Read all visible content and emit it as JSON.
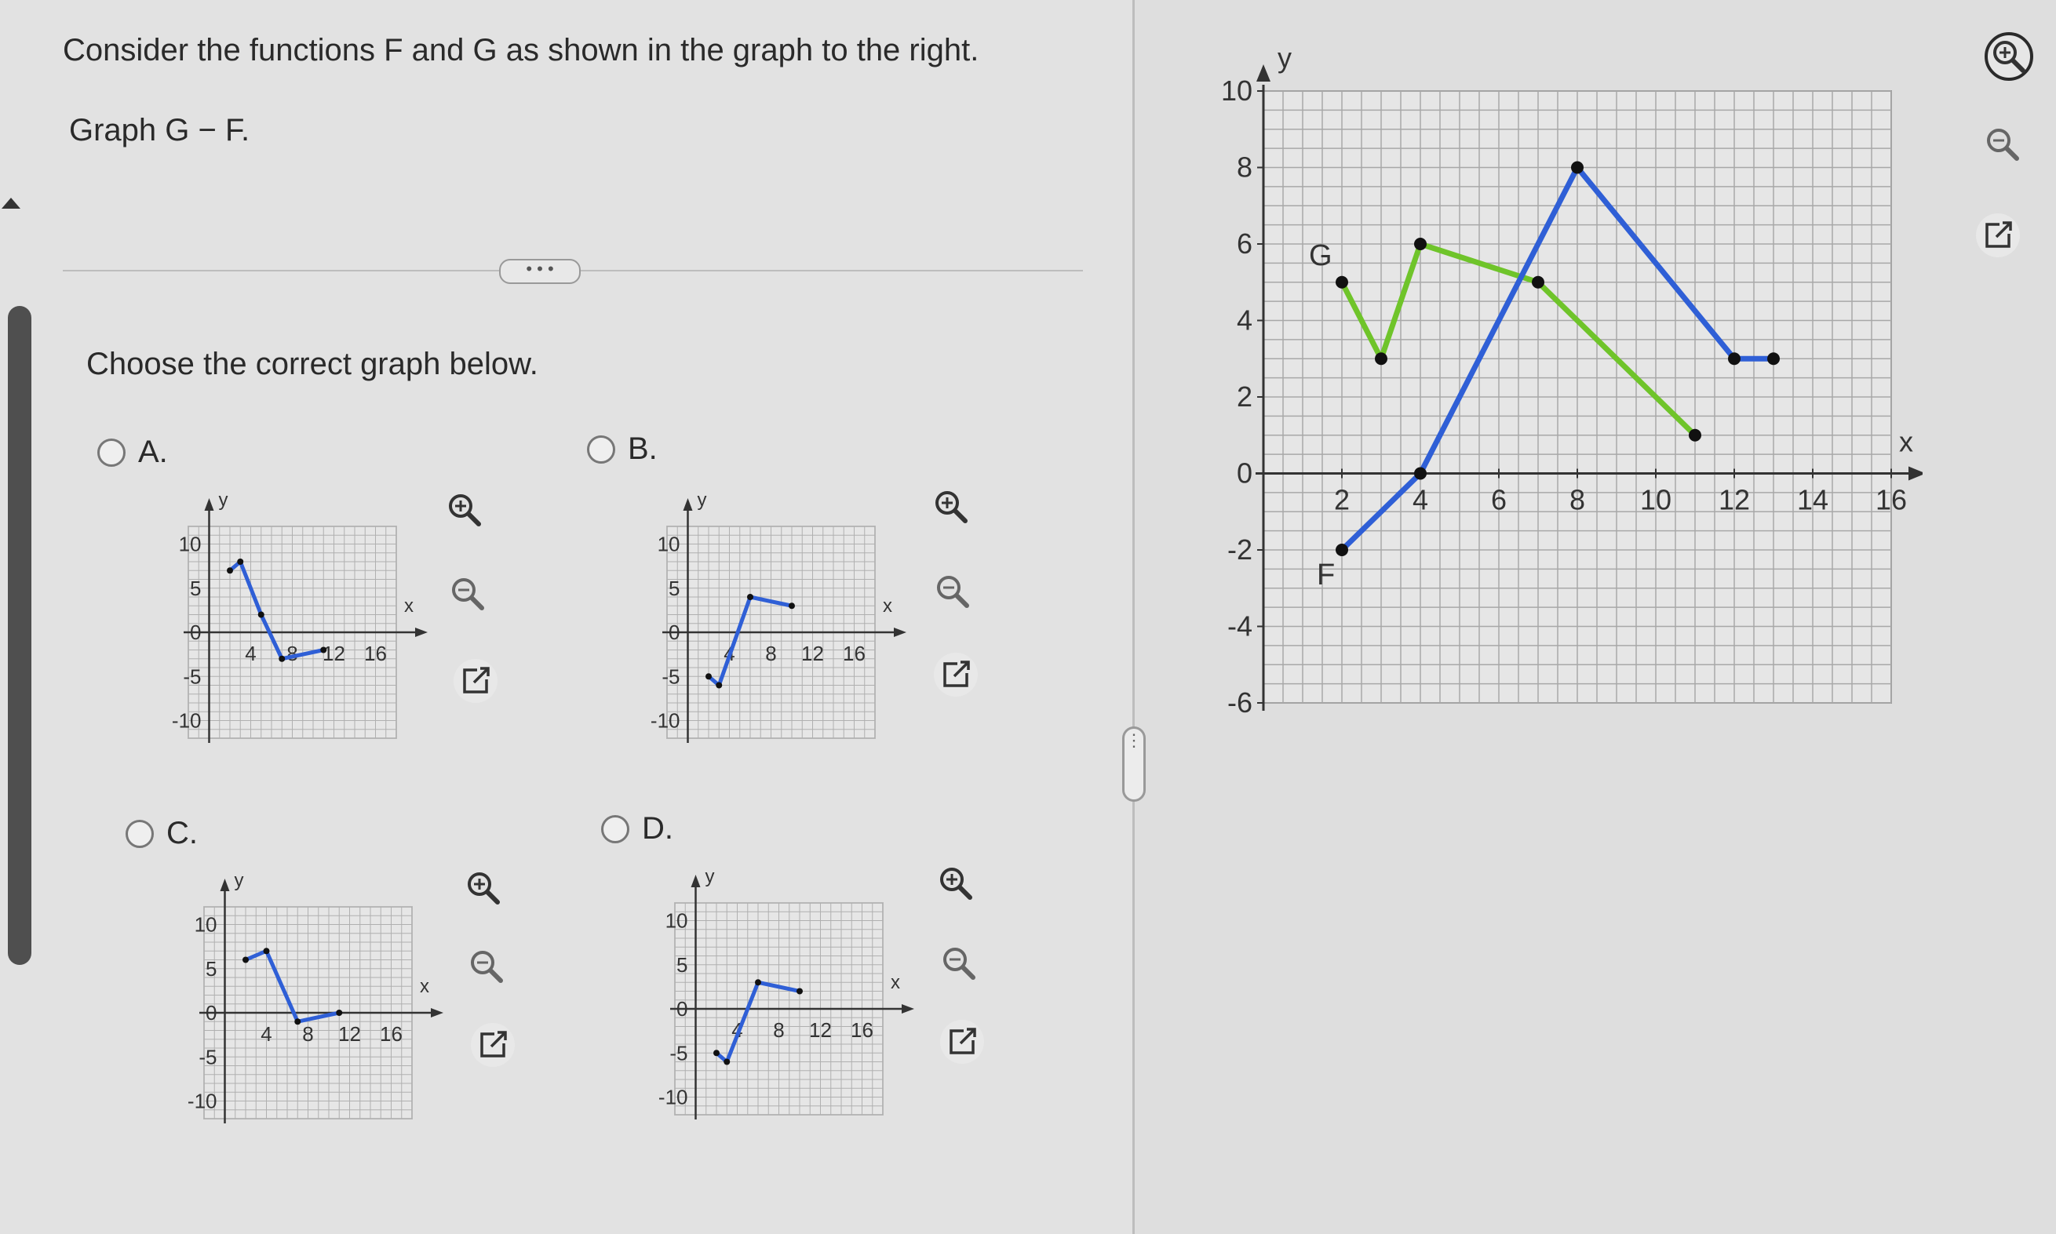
{
  "question": {
    "prompt": "Consider the functions F and G as shown in the graph to the right.",
    "instruction": "Graph G − F.",
    "more_button": "• • •",
    "choose": "Choose the correct graph below."
  },
  "options": [
    {
      "label": "A."
    },
    {
      "label": "B."
    },
    {
      "label": "C."
    },
    {
      "label": "D."
    }
  ],
  "icons": {
    "zoom_in": "zoom-in-icon",
    "zoom_out": "zoom-out-icon",
    "open_new": "open-in-new-window-icon"
  },
  "colors": {
    "F": "#2f5fd6",
    "G": "#6fc42a",
    "answer_line": "#2f5fd6",
    "grid": "#a8a8a8"
  },
  "mini_axes": {
    "y_label": "y",
    "x_label": "x",
    "y_ticks": [
      "10",
      "5",
      "0",
      "-5",
      "-10"
    ],
    "x_ticks": [
      "4",
      "8",
      "12",
      "16"
    ]
  },
  "chart_data": {
    "type": "line",
    "xlabel": "x",
    "ylabel": "y",
    "xlim": [
      0,
      16
    ],
    "ylim": [
      -6,
      10
    ],
    "x_ticks": [
      "2",
      "4",
      "6",
      "8",
      "10",
      "12",
      "14",
      "16"
    ],
    "y_ticks": [
      "10",
      "8",
      "6",
      "4",
      "2",
      "0",
      "-2",
      "-4",
      "-6"
    ],
    "grid": true,
    "series": [
      {
        "name": "F",
        "points": [
          [
            2,
            -2
          ],
          [
            4,
            0
          ],
          [
            8,
            8
          ],
          [
            12,
            3
          ],
          [
            13,
            3
          ]
        ]
      },
      {
        "name": "G",
        "points": [
          [
            2,
            5
          ],
          [
            3,
            3
          ],
          [
            4,
            6
          ],
          [
            7,
            5
          ],
          [
            11,
            1
          ]
        ]
      }
    ]
  }
}
